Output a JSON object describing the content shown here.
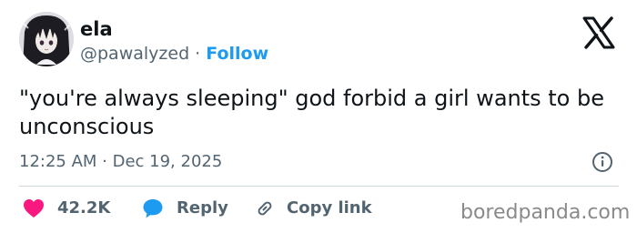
{
  "tweet": {
    "author": {
      "display_name": "ela",
      "handle": "@pawalyzed",
      "separator": " · ",
      "follow_label": "Follow",
      "avatar_icon": "avatar-anime-girl"
    },
    "text": "\"you're always sleeping\" god forbid a girl wants to be unconscious",
    "timestamp": "12:25 AM · Dec 19, 2025",
    "actions": {
      "like": {
        "icon": "heart-icon",
        "count": "42.2K",
        "color": "#f91880"
      },
      "reply": {
        "icon": "speech-bubble-icon",
        "label": "Reply",
        "color": "#1d9bf0"
      },
      "copy_link": {
        "icon": "link-icon",
        "label": "Copy link"
      }
    }
  },
  "watermark": "boredpanda.com",
  "colors": {
    "text": "#0f1419",
    "muted": "#536471",
    "accent": "#1d9bf0",
    "like": "#f91880",
    "divider": "#cfd9de"
  }
}
